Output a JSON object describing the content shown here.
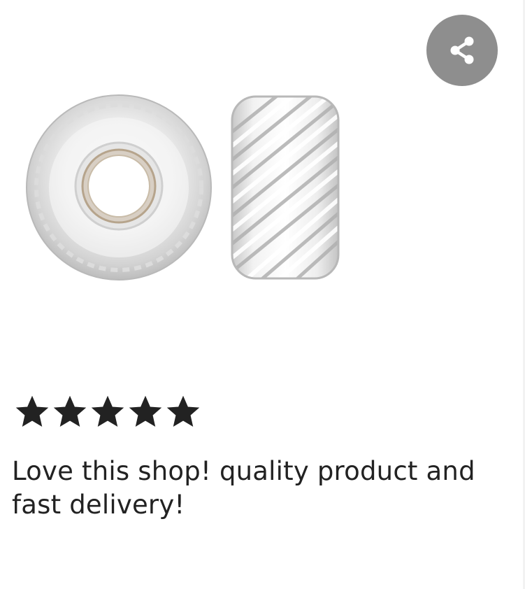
{
  "share": {
    "icon": "share-icon",
    "button_color": "#8e8e8e"
  },
  "product_image": {
    "description_icon": "bead-image"
  },
  "review": {
    "rating": 5,
    "rating_max": 5,
    "star_color": "#222222",
    "text": "Love this shop! quality product and fast delivery!"
  }
}
